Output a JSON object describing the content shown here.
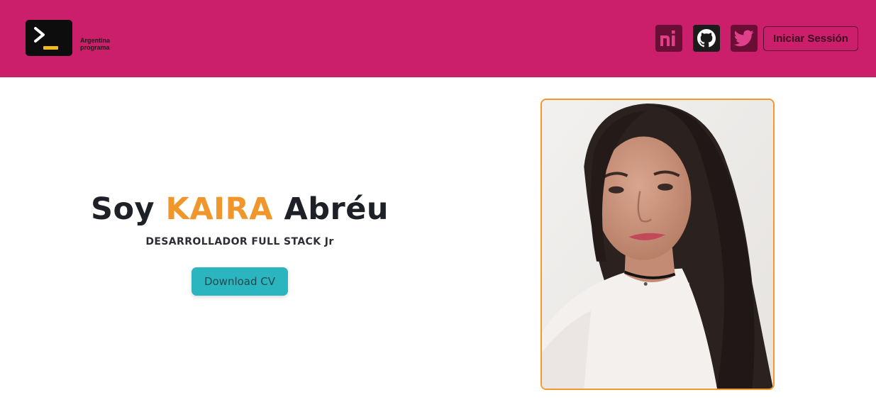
{
  "header": {
    "logo": {
      "line1": "Argentina",
      "line2": "programa",
      "accent_color": "#f2b91b"
    },
    "social": [
      {
        "name": "argentina-programa",
        "icon": "ap-logo-icon",
        "label": "ni"
      },
      {
        "name": "github",
        "icon": "github-icon"
      },
      {
        "name": "twitter",
        "icon": "twitter-bird-icon"
      }
    ],
    "login_label": "Iniciar Sessión",
    "background_color": "#cb1f6b"
  },
  "hero": {
    "title_prefix": "Soy",
    "title_highlight": "KAIRA",
    "title_suffix": "Abréu",
    "highlight_color": "#f0962b",
    "subtitle": "DESARROLLADOR FULL STACK Jr",
    "cv_button_label": "Download CV",
    "cv_button_color": "#2ab5bf"
  },
  "profile_photo": {
    "icon": "portrait-photo",
    "border_color": "#f09a2a"
  }
}
